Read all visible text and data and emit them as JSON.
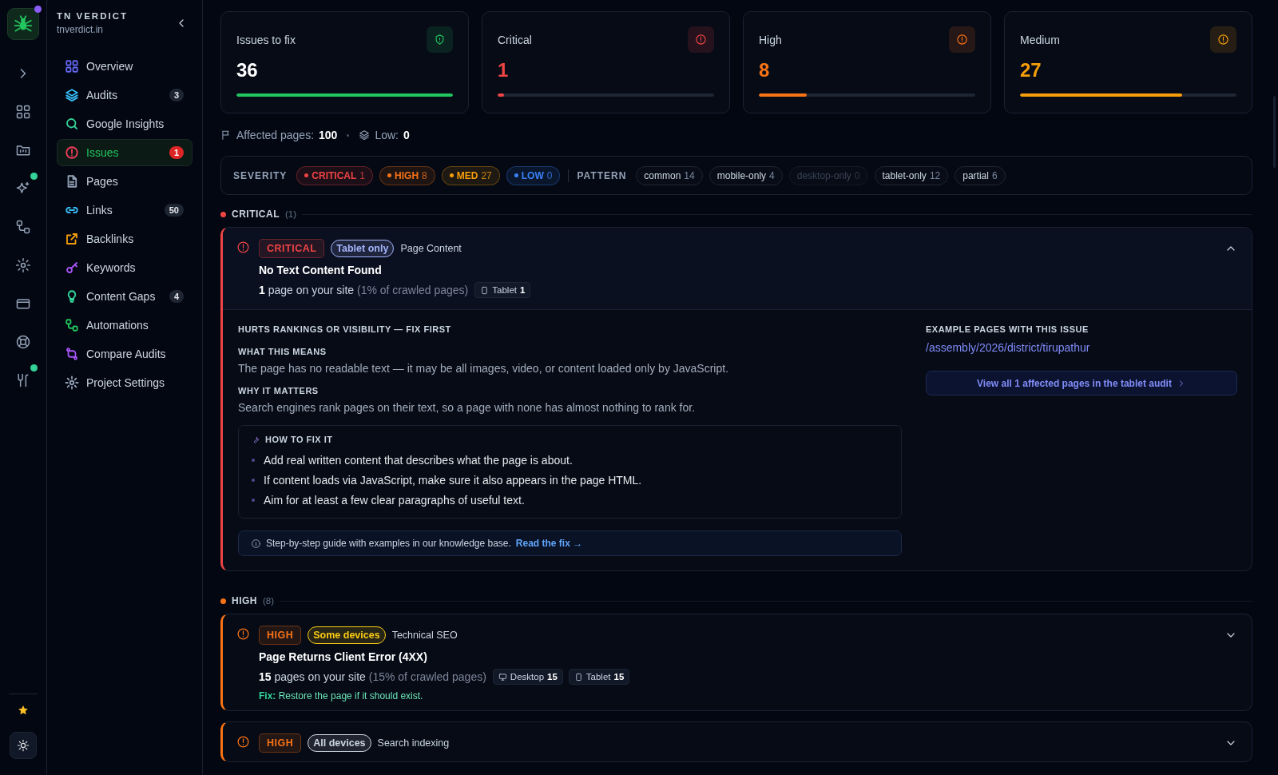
{
  "rail": {
    "logo_badge": true,
    "items": [
      {
        "badge": false
      },
      {
        "badge": false
      },
      {
        "badge": false
      },
      {
        "badge": true
      },
      {
        "badge": false
      },
      {
        "badge": false
      },
      {
        "badge": false
      },
      {
        "badge": false
      },
      {
        "badge": true
      }
    ]
  },
  "sidebar": {
    "title": "TN VERDICT",
    "subtitle": "tnverdict.in",
    "items": [
      {
        "label": "Overview",
        "color": "#6366f1",
        "selected": false
      },
      {
        "label": "Audits",
        "color": "#38bdf8",
        "count": "3",
        "selected": false
      },
      {
        "label": "Google Insights",
        "color": "#34d399",
        "selected": false
      },
      {
        "label": "Issues",
        "color": "#f43f5e",
        "count": "1",
        "selected": true
      },
      {
        "label": "Pages",
        "color": "#94a3b8",
        "selected": false
      },
      {
        "label": "Links",
        "color": "#38bdf8",
        "count": "50",
        "selected": false
      },
      {
        "label": "Backlinks",
        "color": "#f59e0b",
        "selected": false
      },
      {
        "label": "Keywords",
        "color": "#a855f7",
        "selected": false
      },
      {
        "label": "Content Gaps",
        "color": "#34d399",
        "count": "4",
        "selected": false
      },
      {
        "label": "Automations",
        "color": "#22c55e",
        "selected": false
      },
      {
        "label": "Compare Audits",
        "color": "#a855f7",
        "selected": false
      },
      {
        "label": "Project Settings",
        "color": "#94a3b8",
        "selected": false
      }
    ]
  },
  "stats": [
    {
      "kind": "total",
      "label": "Issues to fix",
      "value": "36",
      "level": 1
    },
    {
      "kind": "critical",
      "label": "Critical",
      "value": "1",
      "level": 0.03
    },
    {
      "kind": "high",
      "label": "High",
      "value": "8",
      "level": 0.22
    },
    {
      "kind": "medium",
      "label": "Medium",
      "value": "27",
      "level": 0.75
    }
  ],
  "summary": {
    "pages_label": "Affected pages:",
    "pages": "100",
    "low_label": "Low:",
    "low": "0"
  },
  "filters": {
    "severity_label": "SEVERITY",
    "severity": [
      {
        "label": "CRITICAL",
        "count": "1",
        "color": "#ef4444"
      },
      {
        "label": "HIGH",
        "count": "8",
        "color": "#f97316"
      },
      {
        "label": "MED",
        "count": "27",
        "color": "#f59e0b"
      },
      {
        "label": "LOW",
        "count": "0",
        "color": "#3b82f6"
      }
    ],
    "pattern_label": "PATTERN",
    "pattern": [
      {
        "label": "common",
        "count": "14",
        "disabled": false
      },
      {
        "label": "mobile-only",
        "count": "4",
        "disabled": false
      },
      {
        "label": "desktop-only",
        "count": "0",
        "disabled": true
      },
      {
        "label": "tablet-only",
        "count": "12",
        "disabled": false
      },
      {
        "label": "partial",
        "count": "6",
        "disabled": false
      }
    ]
  },
  "sections": [
    {
      "kind": "critical",
      "label": "CRITICAL",
      "count": "(1)",
      "issues": [
        {
          "badge": "CRITICAL",
          "scope": {
            "label": "Tablet only",
            "color": "#a5b4fc"
          },
          "category": "Page Content",
          "title": "No Text Content Found",
          "count": "1",
          "count_text": "page on your site",
          "share": "(1% of crawled pages)",
          "devices": [
            {
              "kind": "tablet",
              "label": "Tablet",
              "count": "1"
            }
          ],
          "expanded": true,
          "details": {
            "impact": "HURTS RANKINGS OR VISIBILITY — FIX FIRST",
            "blocks": [
              {
                "heading": "WHAT THIS MEANS",
                "text": "The page has no readable text — it may be all images, video, or content loaded only by JavaScript."
              },
              {
                "heading": "WHY IT MATTERS",
                "text": "Search engines rank pages on their text, so a page with none has almost nothing to rank for."
              }
            ],
            "howto": {
              "heading": "HOW TO FIX IT",
              "steps": [
                "Add real written content that describes what the page is about.",
                "If content loads via JavaScript, make sure it also appears in the page HTML.",
                "Aim for at least a few clear paragraphs of useful text."
              ]
            },
            "guide": {
              "text": "Step-by-step guide with examples in our knowledge base.",
              "link": "Read the fix →"
            },
            "examples": {
              "heading": "EXAMPLE PAGES WITH THIS ISSUE",
              "pages": [
                "/assembly/2026/district/tirupathur"
              ],
              "button": "View all 1 affected pages in the tablet audit"
            }
          }
        }
      ]
    },
    {
      "kind": "high",
      "label": "HIGH",
      "count": "(8)",
      "issues": [
        {
          "badge": "HIGH",
          "scope": {
            "label": "Some devices",
            "color": "#facc15"
          },
          "category": "Technical SEO",
          "title": "Page Returns Client Error (4XX)",
          "count": "15",
          "count_text": "pages on your site",
          "share": "(15% of crawled pages)",
          "devices": [
            {
              "kind": "desktop",
              "label": "Desktop",
              "count": "15"
            },
            {
              "kind": "tablet",
              "label": "Tablet",
              "count": "15"
            }
          ],
          "expanded": false,
          "fix_label": "Fix:",
          "fix": "Restore the page if it should exist."
        },
        {
          "badge": "HIGH",
          "scope": {
            "label": "All devices",
            "color": "#cbd5e1"
          },
          "category": "Search indexing",
          "expanded": false
        }
      ]
    }
  ]
}
